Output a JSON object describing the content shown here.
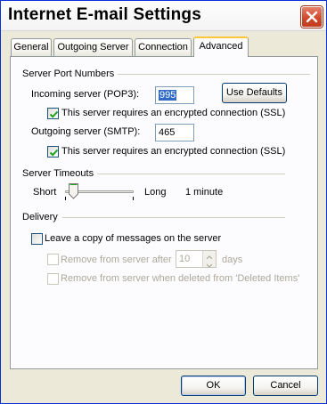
{
  "window": {
    "title": "Internet E-mail Settings",
    "close_icon": "close-x-icon"
  },
  "tabs": [
    {
      "label": "General",
      "active": false
    },
    {
      "label": "Outgoing Server",
      "active": false
    },
    {
      "label": "Connection",
      "active": false
    },
    {
      "label": "Advanced",
      "active": true
    }
  ],
  "server_ports": {
    "heading": "Server Port Numbers",
    "incoming_label": "Incoming server (POP3):",
    "incoming_value": "995",
    "use_defaults_label": "Use Defaults",
    "incoming_ssl_label": "This server requires an encrypted connection (SSL)",
    "incoming_ssl_checked": true,
    "outgoing_label": "Outgoing server (SMTP):",
    "outgoing_value": "465",
    "outgoing_ssl_label": "This server requires an encrypted connection (SSL)",
    "outgoing_ssl_checked": true
  },
  "timeouts": {
    "heading": "Server Timeouts",
    "short_label": "Short",
    "long_label": "Long",
    "value_label": "1 minute",
    "slider_level": 0.1
  },
  "delivery": {
    "heading": "Delivery",
    "leave_copy_label": "Leave a copy of messages on the server",
    "leave_copy_checked": false,
    "remove_after_label": "Remove from server after",
    "remove_after_value": "10",
    "remove_after_unit": "days",
    "remove_after_checked": false,
    "remove_deleted_label": "Remove from server when deleted from 'Deleted Items'",
    "remove_deleted_checked": false
  },
  "buttons": {
    "ok_label": "OK",
    "cancel_label": "Cancel"
  },
  "colors": {
    "accent_tab": "#ffc83c",
    "close_button": "#d14a2c",
    "selection": "#316ac5"
  }
}
